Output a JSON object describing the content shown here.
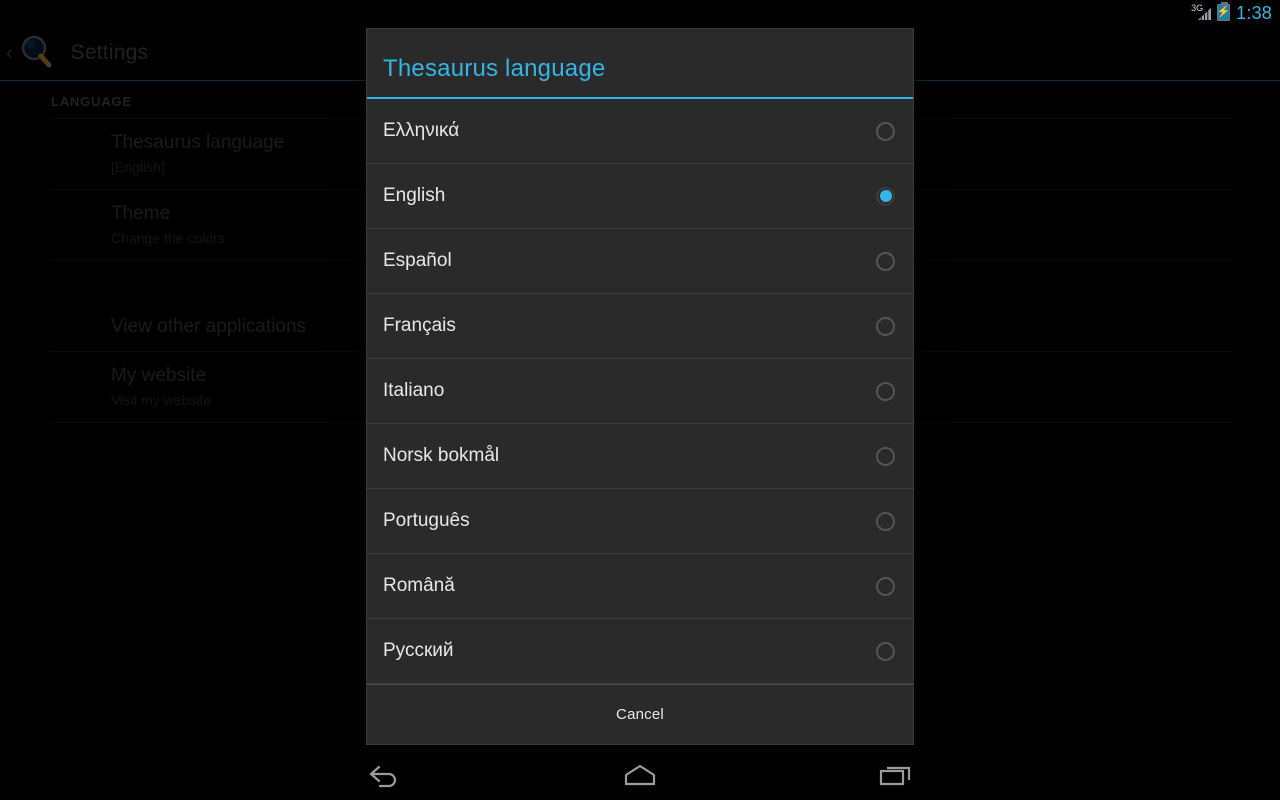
{
  "status_bar": {
    "network_label": "3G",
    "network_icon": "signal-bars-icon",
    "battery_icon": "battery-charging-icon",
    "clock": "1:38",
    "accent_color": "#33b5e5"
  },
  "background_screen": {
    "app_icon": "magnifier-icon",
    "back_chevron": "‹",
    "title": "Settings",
    "section_header": "LANGUAGE",
    "rows": [
      {
        "title": "Thesaurus language",
        "subtitle": "[English]"
      },
      {
        "title": "Theme",
        "subtitle": "Change the colors"
      },
      {
        "title": "View other applications",
        "subtitle": ""
      },
      {
        "title": "My website",
        "subtitle": "Visit my website"
      }
    ]
  },
  "dialog": {
    "title": "Thesaurus language",
    "accent_color": "#33b5e5",
    "selected_value": "English",
    "options": [
      {
        "label": "Ελληνικά",
        "selected": false
      },
      {
        "label": "English",
        "selected": true
      },
      {
        "label": "Español",
        "selected": false
      },
      {
        "label": "Français",
        "selected": false
      },
      {
        "label": "Italiano",
        "selected": false
      },
      {
        "label": "Norsk bokmål",
        "selected": false
      },
      {
        "label": "Português",
        "selected": false
      },
      {
        "label": "Română",
        "selected": false
      },
      {
        "label": "Русский",
        "selected": false
      }
    ],
    "cancel_label": "Cancel"
  },
  "navigation_bar": {
    "buttons": [
      {
        "name": "back-icon",
        "label": "Back"
      },
      {
        "name": "home-icon",
        "label": "Home"
      },
      {
        "name": "recents-icon",
        "label": "Recent apps"
      }
    ]
  }
}
